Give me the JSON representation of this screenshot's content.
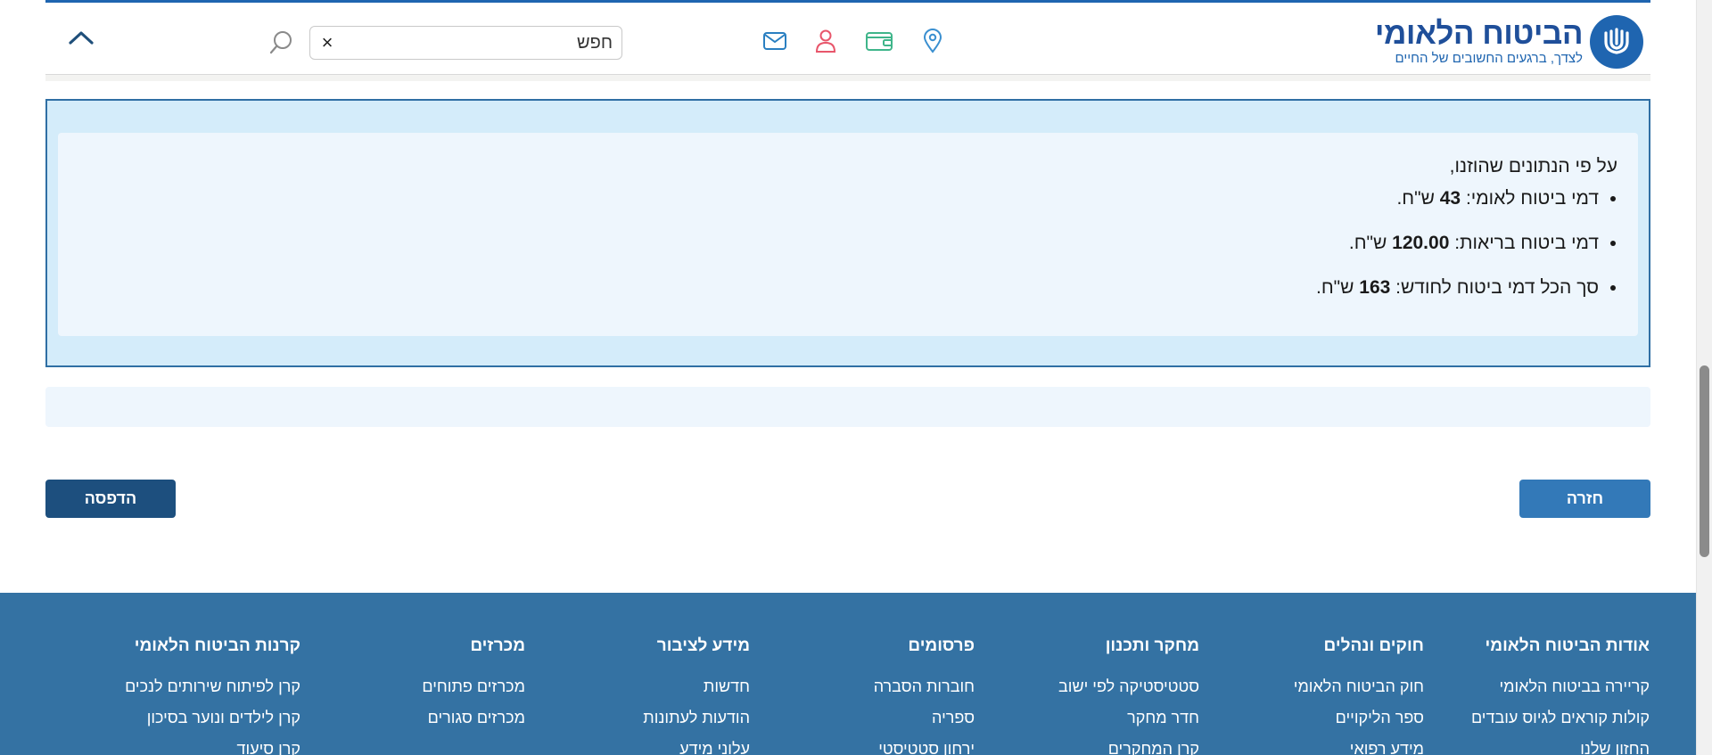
{
  "header": {
    "logo": {
      "title": "הביטוח הלאומי",
      "subtitle": "לצדך, ברגעים החשובים של החיים"
    },
    "search": {
      "placeholder": "חפש",
      "clear_label": "×"
    },
    "icons": [
      "location-icon",
      "wallet-icon",
      "user-icon",
      "mail-icon",
      "search-icon",
      "chevron-up-icon"
    ],
    "colors": {
      "accent": "#1f65b0",
      "location": "#3a8fd0",
      "wallet": "#3fb58a",
      "user": "#e8566b",
      "mail": "#2a7fc1"
    }
  },
  "result": {
    "intro": "על פי הנתונים שהוזנו,",
    "items": [
      {
        "prefix": "דמי ביטוח לאומי: ",
        "value": "43",
        "suffix": " ש\"ח."
      },
      {
        "prefix": "דמי ביטוח בריאות: ",
        "value": "120.00",
        "suffix": " ש\"ח."
      },
      {
        "prefix": "סך הכל דמי ביטוח לחודש: ",
        "value": "163",
        "suffix": " ש\"ח."
      }
    ]
  },
  "buttons": {
    "back_label": "חזרה",
    "print_label": "הדפסה"
  },
  "footer": {
    "columns": [
      {
        "title": "אודות הביטוח הלאומי",
        "links": [
          "קריירה בביטוח הלאומי",
          "קולות קוראים לגיוס עובדים",
          "החזון שלנו"
        ]
      },
      {
        "title": "חוקים ונהלים",
        "links": [
          "חוק הביטוח הלאומי",
          "ספר הליקויים",
          "מידע רפואי"
        ]
      },
      {
        "title": "מחקר ותכנון",
        "links": [
          "סטטיסטיקה לפי ישוב",
          "חדר מחקר",
          "קרן המחקרים"
        ]
      },
      {
        "title": "פרסומים",
        "links": [
          "חוברות הסברה",
          "ספריה",
          "ירחון סטטיסטי"
        ]
      },
      {
        "title": "מידע לציבור",
        "links": [
          "חדשות",
          "הודעות לעתונות",
          "עלוני מידע"
        ]
      },
      {
        "title": "מכרזים",
        "links": [
          "מכרזים פתוחים",
          "מכרזים סגורים"
        ]
      },
      {
        "title": "קרנות הביטוח הלאומי",
        "links": [
          "קרן לפיתוח שירותים לנכים",
          "קרן לילדים ונוער בסיכון",
          "קרן סיעוד"
        ]
      }
    ]
  }
}
